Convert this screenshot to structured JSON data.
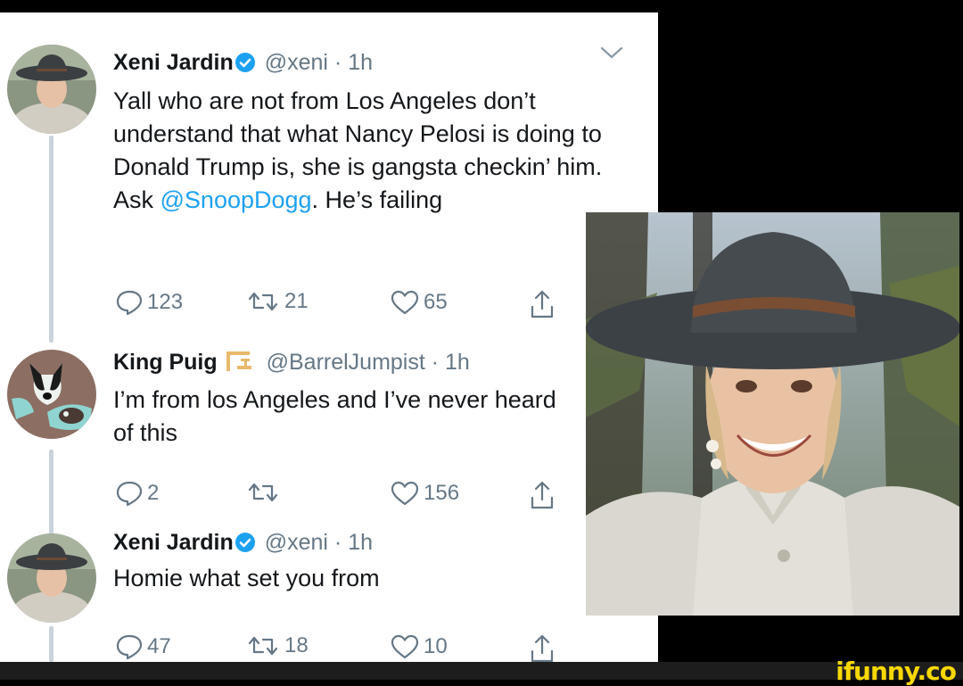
{
  "tweets": [
    {
      "name": "Xeni Jardin",
      "handle": "@xeni",
      "time": "1h",
      "text_before": "Yall who are not from Los Angeles don’t understand that what Nancy Pelosi is doing to Donald Trump is, she is gangsta checkin’ him. Ask ",
      "mention": "@SnoopDogg",
      "text_after": ".  He’s failing",
      "reply_count": "123",
      "retweet_count": "21",
      "like_count": "65"
    },
    {
      "name": "King Puig",
      "handle": "@BarrelJumpist",
      "time": "1h",
      "text": "I’m from los Angeles and I’ve never heard of this",
      "reply_count": "2",
      "retweet_count": "",
      "like_count": "156"
    },
    {
      "name": "Xeni Jardin",
      "handle": "@xeni",
      "time": "1h",
      "text": "Homie what set you from",
      "reply_count": "47",
      "retweet_count": "18",
      "like_count": "10"
    }
  ],
  "separator": " · ",
  "watermark": "ifunny.co",
  "colors": {
    "link": "#1da1f2",
    "muted": "#657786",
    "text": "#14171a",
    "verified": "#1da1f2",
    "watermark": "#f8d800"
  }
}
